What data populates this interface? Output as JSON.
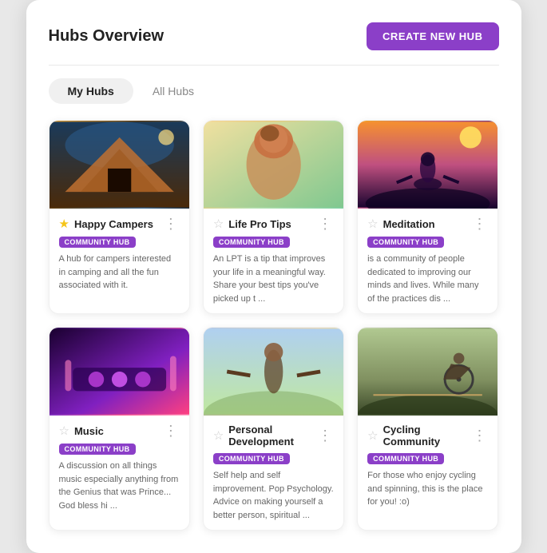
{
  "header": {
    "title": "Hubs Overview",
    "create_button": "CREATE NEW HUB"
  },
  "tabs": [
    {
      "id": "my-hubs",
      "label": "My Hubs",
      "active": true
    },
    {
      "id": "all-hubs",
      "label": "All Hubs",
      "active": false
    }
  ],
  "hubs": [
    {
      "id": "happy-campers",
      "title": "Happy Campers",
      "badge": "COMMUNITY HUB",
      "starred": true,
      "desc": "A hub for campers interested in camping and all the fun associated with it.",
      "img_class": "img-camping"
    },
    {
      "id": "life-pro-tips",
      "title": "Life Pro Tips",
      "badge": "COMMUNITY HUB",
      "starred": false,
      "desc": "An LPT is a tip that improves your life in a meaningful way. Share your best tips you've picked up t ...",
      "img_class": "img-lifepro"
    },
    {
      "id": "meditation",
      "title": "Meditation",
      "badge": "COMMUNITY HUB",
      "starred": false,
      "desc": "is a community of people dedicated to improving our minds and lives. While many of the practices dis ...",
      "img_class": "img-meditation"
    },
    {
      "id": "music",
      "title": "Music",
      "badge": "COMMUNITY HUB",
      "starred": false,
      "desc": "A discussion on all things music especially anything from the Genius that was Prince... God bless hi ...",
      "img_class": "img-music"
    },
    {
      "id": "personal-development",
      "title": "Personal Development",
      "badge": "COMMUNITY HUB",
      "starred": false,
      "desc": "Self help and self improvement. Pop Psychology. Advice on making yourself a better person, spiritual ...",
      "img_class": "img-personal"
    },
    {
      "id": "cycling-community",
      "title": "Cycling Community",
      "badge": "COMMUNITY HUB",
      "starred": false,
      "desc": "For those who enjoy cycling and spinning, this is the place for you! :o)",
      "img_class": "img-cycling"
    }
  ],
  "icons": {
    "star_filled": "★",
    "star_empty": "☆",
    "more": "⋮"
  }
}
